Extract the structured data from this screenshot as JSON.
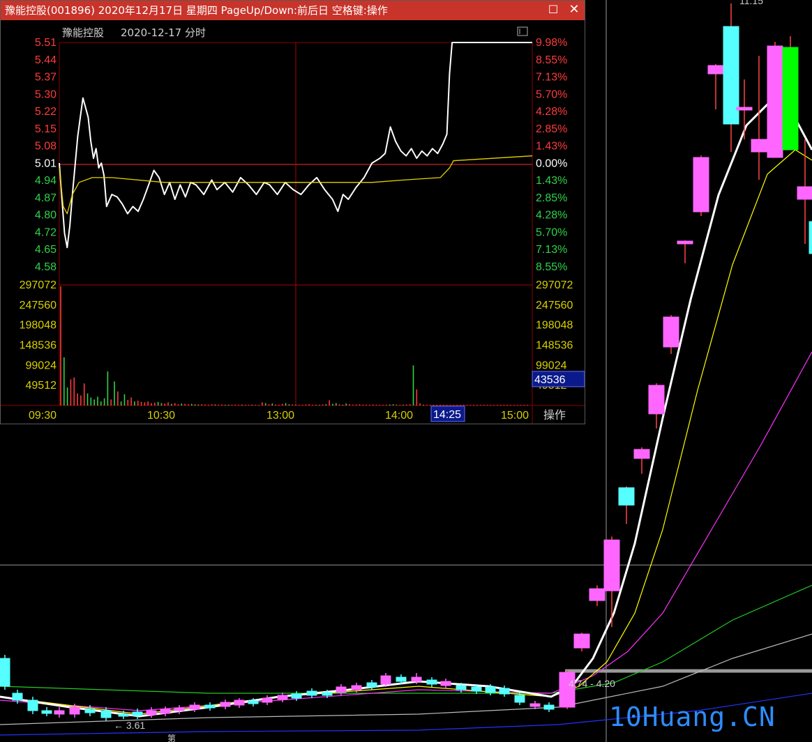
{
  "window": {
    "title": "豫能控股(001896) 2020年12月17日 星期四 PageUp/Down:前后日 空格键:操作",
    "maximize_icon": "maximize-icon",
    "close_icon": "close-icon"
  },
  "intraday": {
    "stock_name": "豫能控股",
    "date_label": "2020-12-17 分时",
    "action_label": "操作",
    "prev_close": 5.01,
    "price_ticks": [
      "5.51",
      "5.44",
      "5.37",
      "5.30",
      "5.22",
      "5.15",
      "5.08",
      "5.01",
      "4.94",
      "4.87",
      "4.80",
      "4.72",
      "4.65",
      "4.58"
    ],
    "pct_ticks": [
      "9.98%",
      "8.55%",
      "7.13%",
      "5.70%",
      "4.28%",
      "2.85%",
      "1.43%",
      "0.00%",
      "1.43%",
      "2.85%",
      "4.28%",
      "5.70%",
      "7.13%",
      "8.55%"
    ],
    "volume_ticks": [
      "297072",
      "247560",
      "198048",
      "148536",
      "99024",
      "49512"
    ],
    "time_ticks": [
      "09:30",
      "10:30",
      "13:00",
      "14:00",
      "15:00"
    ],
    "cursor_time": "14:25",
    "cursor_volume": "43536",
    "colors": {
      "up": "#ff3b3b",
      "down": "#2fd34a",
      "price": "#ffffff",
      "avg": "#e6d200",
      "grid": "#8b0000",
      "axis_yellow": "#d8d000"
    }
  },
  "chart_data": [
    {
      "type": "line",
      "title": "",
      "series": [
        {
          "name": "price",
          "points": [
            [
              0,
              5.01
            ],
            [
              2,
              4.86
            ],
            [
              4,
              4.72
            ],
            [
              6,
              4.66
            ],
            [
              8,
              4.75
            ],
            [
              10,
              4.88
            ],
            [
              12,
              5.0
            ],
            [
              14,
              5.12
            ],
            [
              16,
              5.2
            ],
            [
              18,
              5.28
            ],
            [
              20,
              5.24
            ],
            [
              22,
              5.2
            ],
            [
              24,
              5.1
            ],
            [
              26,
              5.03
            ],
            [
              28,
              5.07
            ],
            [
              30,
              4.99
            ],
            [
              32,
              5.01
            ],
            [
              34,
              4.96
            ],
            [
              36,
              4.83
            ],
            [
              40,
              4.88
            ],
            [
              44,
              4.87
            ],
            [
              48,
              4.84
            ],
            [
              52,
              4.8
            ],
            [
              56,
              4.83
            ],
            [
              60,
              4.81
            ],
            [
              64,
              4.86
            ],
            [
              68,
              4.92
            ],
            [
              72,
              4.98
            ],
            [
              76,
              4.95
            ],
            [
              80,
              4.88
            ],
            [
              84,
              4.93
            ],
            [
              88,
              4.86
            ],
            [
              92,
              4.92
            ],
            [
              96,
              4.87
            ],
            [
              100,
              4.93
            ],
            [
              104,
              4.92
            ],
            [
              110,
              4.88
            ],
            [
              116,
              4.94
            ],
            [
              120,
              4.9
            ],
            [
              126,
              4.93
            ],
            [
              132,
              4.89
            ],
            [
              138,
              4.95
            ],
            [
              144,
              4.92
            ],
            [
              150,
              4.88
            ],
            [
              156,
              4.93
            ],
            [
              160,
              4.92
            ],
            [
              166,
              4.88
            ],
            [
              172,
              4.93
            ],
            [
              178,
              4.9
            ],
            [
              184,
              4.88
            ],
            [
              190,
              4.92
            ],
            [
              196,
              4.95
            ],
            [
              202,
              4.9
            ],
            [
              208,
              4.86
            ],
            [
              212,
              4.81
            ],
            [
              216,
              4.88
            ],
            [
              220,
              4.86
            ],
            [
              226,
              4.91
            ],
            [
              232,
              4.95
            ],
            [
              238,
              5.01
            ],
            [
              244,
              5.03
            ],
            [
              248,
              5.05
            ],
            [
              252,
              5.16
            ],
            [
              256,
              5.1
            ],
            [
              260,
              5.06
            ],
            [
              264,
              5.04
            ],
            [
              268,
              5.07
            ],
            [
              272,
              5.03
            ],
            [
              276,
              5.06
            ],
            [
              280,
              5.04
            ],
            [
              284,
              5.07
            ],
            [
              288,
              5.05
            ],
            [
              292,
              5.09
            ],
            [
              295,
              5.13
            ],
            [
              297,
              5.38
            ],
            [
              299,
              5.51
            ],
            [
              310,
              5.51
            ],
            [
              330,
              5.51
            ],
            [
              360,
              5.51
            ]
          ]
        },
        {
          "name": "average",
          "points": [
            [
              0,
              4.99
            ],
            [
              3,
              4.83
            ],
            [
              6,
              4.8
            ],
            [
              10,
              4.88
            ],
            [
              15,
              4.93
            ],
            [
              25,
              4.95
            ],
            [
              40,
              4.95
            ],
            [
              80,
              4.93
            ],
            [
              120,
              4.93
            ],
            [
              160,
              4.93
            ],
            [
              200,
              4.93
            ],
            [
              238,
              4.93
            ],
            [
              262,
              4.94
            ],
            [
              290,
              4.95
            ],
            [
              297,
              4.99
            ],
            [
              300,
              5.02
            ],
            [
              330,
              5.03
            ],
            [
              360,
              5.04
            ]
          ]
        }
      ],
      "ylim": [
        4.58,
        5.51
      ],
      "xlim": [
        0,
        360
      ]
    },
    {
      "type": "bar",
      "title": "",
      "series": [
        {
          "name": "volume",
          "values": [
            297072,
            120000,
            45000,
            65000,
            70000,
            30000,
            25000,
            55000,
            30000,
            20000,
            15000,
            22000,
            10000,
            18000,
            85000,
            15000,
            60000,
            35000,
            10000,
            28000,
            14000,
            20000,
            10000,
            12000,
            9000,
            8000,
            10000,
            6000,
            7000,
            9000,
            6000,
            5000,
            8000,
            4000,
            6000,
            3000,
            5000,
            4000,
            3000,
            4000,
            3000,
            2500,
            3000,
            2500,
            2000,
            3000,
            2500,
            2000,
            2500,
            2000,
            2000,
            1800,
            2200,
            1500,
            2000,
            1800,
            1500,
            2000,
            1600,
            1200,
            8000,
            6000,
            3000,
            5000,
            2500,
            2000,
            4000,
            6000,
            3000,
            2500,
            2000,
            1500,
            2000,
            2500,
            3000,
            1500,
            2000,
            1800,
            2500,
            3000,
            13000,
            4000,
            6000,
            3000,
            2000,
            5000,
            3500,
            2000,
            2500,
            3000,
            2000,
            2000,
            1800,
            2500,
            2000,
            1800,
            1500,
            2000,
            2500,
            3000,
            2000,
            1500,
            2000,
            2500,
            3000,
            100000,
            40000,
            5000,
            2000,
            1500,
            1200,
            1000,
            800,
            700,
            600,
            500,
            500,
            600,
            400,
            500,
            400,
            400,
            500,
            400,
            300,
            400,
            300,
            300,
            400,
            300,
            300,
            250,
            300,
            300,
            200,
            200,
            250,
            300,
            200,
            200
          ]
        }
      ],
      "ylim": [
        0,
        297072
      ]
    }
  ],
  "kline": {
    "labels": {
      "high_label": "11.15",
      "low_label": "← 3.61",
      "range_label": "4.74 - 4.20",
      "small_label": "第"
    },
    "colors": {
      "up": "#ff66ff",
      "down": "#55ffff",
      "limit_down": "#00ff00",
      "ma5": "#ffffff",
      "ma10": "#ffff00",
      "ma20": "#ff33ff",
      "ma60": "#22cc22",
      "ma120": "#bbbbbb",
      "ma250": "#2233ff"
    }
  },
  "watermark": {
    "text": "10Huang.CN"
  }
}
